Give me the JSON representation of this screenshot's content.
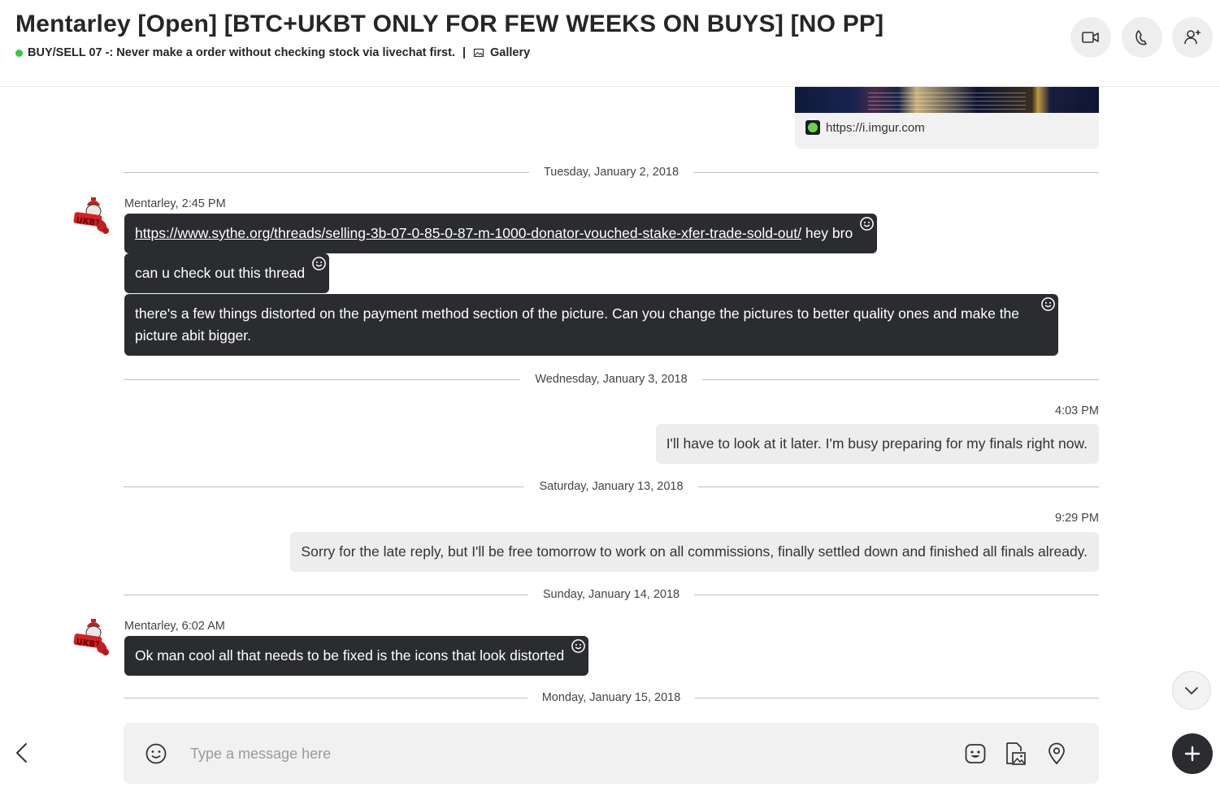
{
  "header": {
    "title": "Mentarley [Open] [BTC+UKBT ONLY FOR FEW WEEKS ON BUYS] [NO PP]",
    "status_text": "BUY/SELL 07 -: Never make a order without checking stock via livechat first.",
    "separator": "|",
    "gallery_label": "Gallery",
    "buttons": [
      {
        "name": "video-call-button",
        "icon": "video-camera-icon"
      },
      {
        "name": "voice-call-button",
        "icon": "phone-icon"
      },
      {
        "name": "add-person-button",
        "icon": "add-person-icon"
      }
    ]
  },
  "link_preview": {
    "url_text": "https://i.imgur.com",
    "icon": "imgur-favicon"
  },
  "day_separators": [
    "Tuesday, January 2, 2018",
    "Wednesday, January 3, 2018",
    "Saturday, January 13, 2018",
    "Sunday, January 14, 2018",
    "Monday, January 15, 2018"
  ],
  "messages": {
    "m1_meta": "Mentarley, 2:45 PM",
    "m1_link": "https://www.sythe.org/threads/selling-3b-07-0-85-0-87-m-1000-donator-vouched-stake-xfer-trade-sold-out/",
    "m1_tail": " hey bro",
    "m2": "can u check out this thread",
    "m3": "there's a few things distorted on the payment method section of the picture. Can you change the pictures to better quality ones and make the picture abit bigger.",
    "out1_time": "4:03 PM",
    "out1": "I'll have to look at it later. I'm busy preparing for my finals right now.",
    "out2_time": "9:29 PM",
    "out2": "Sorry for the late reply, but I'll be free tomorrow to work on all commissions, finally settled down and finished all finals already.",
    "m4_meta": "Mentarley, 6:02 AM",
    "m4": "Ok man cool all that needs to be fixed is the icons that look distorted"
  },
  "composer": {
    "placeholder": "Type a message here",
    "icons": [
      "emoji-icon",
      "sticker-icon",
      "media-icon",
      "location-icon"
    ]
  },
  "colors": {
    "incoming_bubble": "#2b2c30",
    "outgoing_bubble": "#ededee",
    "online_dot": "#36c64a"
  }
}
